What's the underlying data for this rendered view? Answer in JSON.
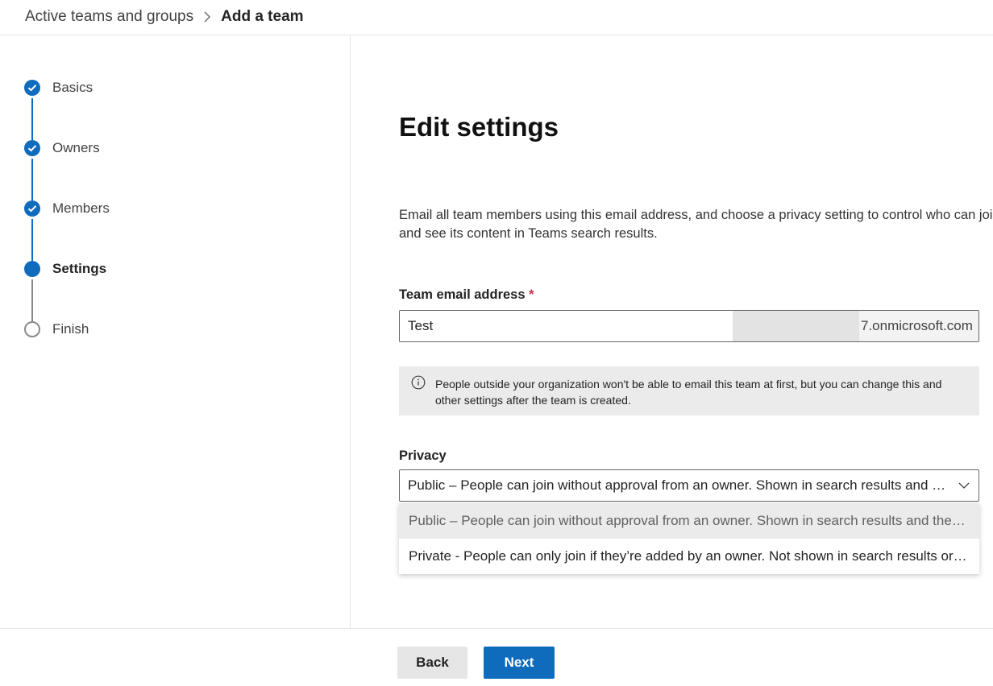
{
  "header": {
    "breadcrumb_parent": "Active teams and groups",
    "breadcrumb_current": "Add a team"
  },
  "steps": [
    {
      "label": "Basics",
      "status": "completed"
    },
    {
      "label": "Owners",
      "status": "completed"
    },
    {
      "label": "Members",
      "status": "completed"
    },
    {
      "label": "Settings",
      "status": "current"
    },
    {
      "label": "Finish",
      "status": "pending"
    }
  ],
  "main": {
    "title": "Edit settings",
    "description": "Email all team members using this email address, and choose a privacy setting to control who can join and see its content in Teams search results.",
    "email_label": "Team email address",
    "required_mark": "*",
    "email_value": "Test",
    "email_domain": "7.onmicrosoft.com",
    "info_text": "People outside your organization won't be able to email this team at first, but you can change this and other settings after the team is created.",
    "privacy_label": "Privacy",
    "privacy_selected": "Public – People can join without approval from an owner. Shown in search results and the Teams gallery.",
    "privacy_options": [
      "Public – People can join without approval from an owner. Shown in search results and the Teams gallery.",
      "Private - People can only join if they’re added by an owner. Not shown in search results or the Teams gallery."
    ]
  },
  "footer": {
    "back_label": "Back",
    "next_label": "Next"
  },
  "colors": {
    "accent": "#0f6cbd",
    "required": "#c4314b",
    "pending_step": "#8a8a8a"
  },
  "icons": {
    "breadcrumb_separator": "chevron-right-icon",
    "step_completed": "checkmark-circle-icon",
    "step_current": "filled-circle-icon",
    "step_pending": "empty-circle-icon",
    "info": "info-icon",
    "dropdown": "chevron-down-icon"
  }
}
